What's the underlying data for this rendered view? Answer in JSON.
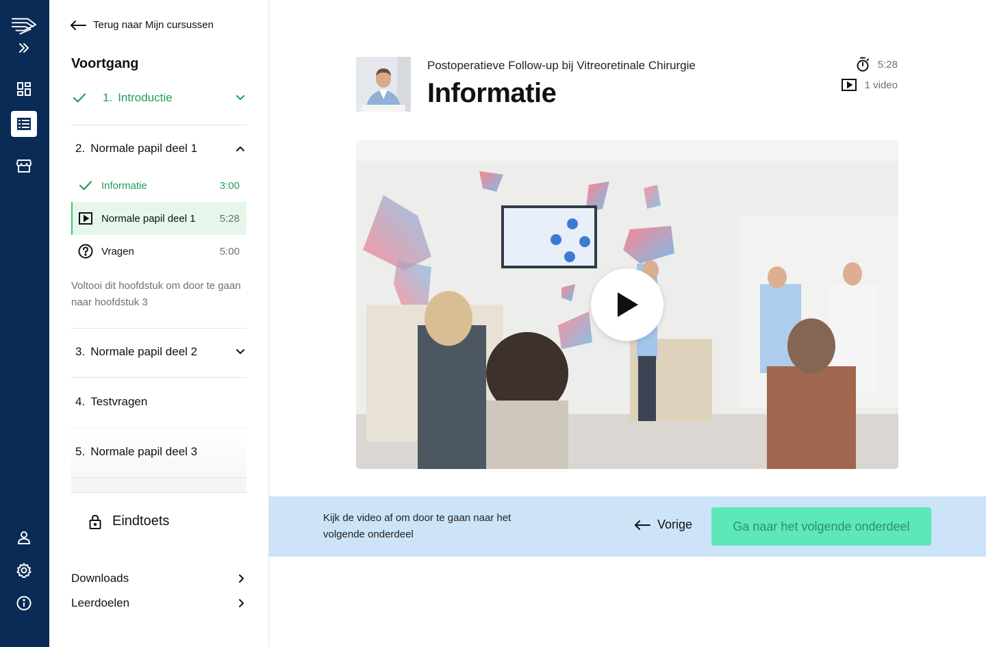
{
  "nav": {
    "logo_icon": "wing-logo-icon",
    "expand_icon": "double-chevron-right-icon",
    "items": [
      "dashboard-icon",
      "course-list-icon",
      "store-icon"
    ],
    "bottom_items": [
      "user-icon",
      "gear-icon",
      "info-icon"
    ],
    "accent": "#0b2b57"
  },
  "sidebar": {
    "back_label": "Terug naar Mijn cursussen",
    "progress_title": "Voortgang",
    "chapters": [
      {
        "num": "1.",
        "title": "Introductie",
        "state": "done"
      },
      {
        "num": "2.",
        "title": "Normale papil deel 1",
        "state": "open"
      },
      {
        "num": "3.",
        "title": "Normale papil deel 2",
        "state": "collapsed"
      },
      {
        "num": "4.",
        "title": "Testvragen",
        "state": "plain"
      },
      {
        "num": "5.",
        "title": "Normale papil deel 3",
        "state": "locked"
      }
    ],
    "lessons": [
      {
        "title": "Informatie",
        "duration": "3:00",
        "state": "done"
      },
      {
        "title": "Normale papil deel 1",
        "duration": "5:28",
        "state": "current"
      },
      {
        "title": "Vragen",
        "duration": "5:00",
        "state": "todo"
      }
    ],
    "chapter_note": "Voltooi dit hoofdstuk om door te gaan naar hoofdstuk 3",
    "final_exam": "Eindtoets",
    "links": [
      "Downloads",
      "Leerdoelen"
    ],
    "done_color": "#1f9d55",
    "current_bg": "#e5f7ea"
  },
  "main": {
    "course_title": "Postoperatieve Follow-up bij Vitreoretinale Chirurgie",
    "lesson_title": "Informatie",
    "duration": "5:28",
    "video_count": "1 video",
    "bar_note": "Kijk de video af om door te gaan naar het volgende onderdeel",
    "prev_label": "Vorige",
    "next_label": "Ga naar het volgende onderdeel",
    "next_color": "#5de8b7",
    "bar_color": "#cde3f8"
  }
}
